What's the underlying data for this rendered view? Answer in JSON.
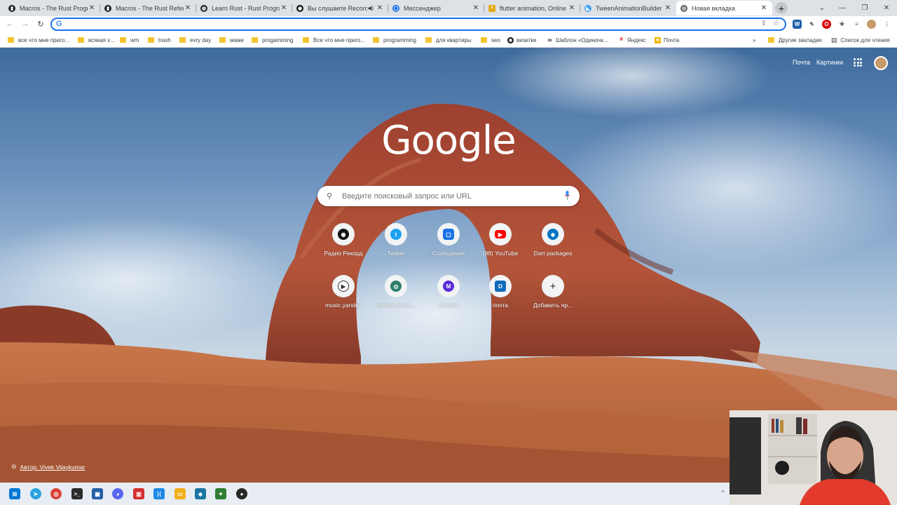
{
  "tabs": [
    {
      "title": "Macros - The Rust Programming",
      "icon": "book-icon",
      "color": "#202124"
    },
    {
      "title": "Macros - The Rust Reference",
      "icon": "book-icon",
      "color": "#202124"
    },
    {
      "title": "Learn Rust - Rust Programming",
      "icon": "globe-icon",
      "color": "#202124"
    },
    {
      "title": "Вы слушаете Record",
      "icon": "record-icon",
      "color": "#111111"
    },
    {
      "title": "Мессенджер",
      "icon": "messenger-icon",
      "color": "#1a73e8"
    },
    {
      "title": "flutter animation, Online V",
      "icon": "stackoverflow-icon",
      "color": "#e6a817"
    },
    {
      "title": "TweenAnimationBuilder cl",
      "icon": "flutter-icon",
      "color": "#42a5f5"
    },
    {
      "title": "Новая вкладка",
      "icon": "chrome-icon",
      "color": "#5f6368"
    }
  ],
  "omnibox": {
    "value": ""
  },
  "bookmarks": [
    {
      "label": "все что мне приго...",
      "type": "folder"
    },
    {
      "label": "всякая х...",
      "type": "folder"
    },
    {
      "label": "wm",
      "type": "folder"
    },
    {
      "label": "trash",
      "type": "folder"
    },
    {
      "label": "evry day",
      "type": "folder"
    },
    {
      "label": "маме",
      "type": "folder"
    },
    {
      "label": "progamming",
      "type": "folder"
    },
    {
      "label": "Все что мне приго...",
      "type": "folder"
    },
    {
      "label": "programming",
      "type": "folder"
    },
    {
      "label": "для квартиры",
      "type": "folder"
    },
    {
      "label": "seo",
      "type": "folder"
    },
    {
      "label": "визитки",
      "type": "site"
    },
    {
      "label": "Шаблон «Одиночк...",
      "type": "site"
    },
    {
      "label": "Яндекс",
      "type": "site"
    },
    {
      "label": "Почта",
      "type": "site"
    }
  ],
  "bookmarks_more": "»",
  "other_bookmarks": "Другие закладки",
  "reading_list": "Список для чтения",
  "ntp": {
    "mail_link": "Почта",
    "images_link": "Картинки",
    "logo": "Google",
    "search_placeholder": "Введите поисковый запрос или URL",
    "credit": "Автор: Vivek Vijaykumar"
  },
  "shortcuts": [
    {
      "label": "Радио Рекорд",
      "icon": "radio-record-icon",
      "color": "#111111",
      "glyph": "◉"
    },
    {
      "label": "Twitter",
      "icon": "twitter-icon",
      "color": "#1da1f2",
      "glyph": "t"
    },
    {
      "label": "Сообщения",
      "icon": "messages-icon",
      "color": "#1a73e8",
      "glyph": "▢"
    },
    {
      "label": "(88) YouTube",
      "icon": "youtube-icon",
      "color": "#ff0000",
      "glyph": "▶"
    },
    {
      "label": "Dart packages",
      "icon": "dart-icon",
      "color": "#0175c2",
      "glyph": "◆"
    },
    {
      "label": "music.yandex",
      "icon": "play-icon",
      "color": "#333333",
      "glyph": "▶"
    },
    {
      "label": "context.rever...",
      "icon": "context-reverso-icon",
      "color": "#2e7d6b",
      "glyph": "◎"
    },
    {
      "label": "vkclient",
      "icon": "vkclient-icon",
      "color": "#5b2bd9",
      "glyph": "M"
    },
    {
      "label": "почта",
      "icon": "outlook-icon",
      "color": "#0f6cbd",
      "glyph": "O"
    },
    {
      "label": "Добавить яр...",
      "icon": "add-icon",
      "color": "#202124",
      "glyph": "+"
    }
  ],
  "taskbar": [
    {
      "icon": "windows-start-icon",
      "color": "#0078d4"
    },
    {
      "icon": "telegram-icon",
      "color": "#2aa3df"
    },
    {
      "icon": "chrome-taskbar-icon",
      "color": "#db4437"
    },
    {
      "icon": "terminal-icon",
      "color": "#2b2b2b"
    },
    {
      "icon": "store-icon",
      "color": "#245fa8"
    },
    {
      "icon": "discord-icon",
      "color": "#5865f2"
    },
    {
      "icon": "books-icon",
      "color": "#d32f2f"
    },
    {
      "icon": "vscode-icon",
      "color": "#1e88e5"
    },
    {
      "icon": "file-explorer-icon",
      "color": "#f2b01e"
    },
    {
      "icon": "network-app-icon",
      "color": "#1976a3"
    },
    {
      "icon": "tree-app-icon",
      "color": "#2e7d32"
    },
    {
      "icon": "obs-icon",
      "color": "#262626"
    }
  ]
}
